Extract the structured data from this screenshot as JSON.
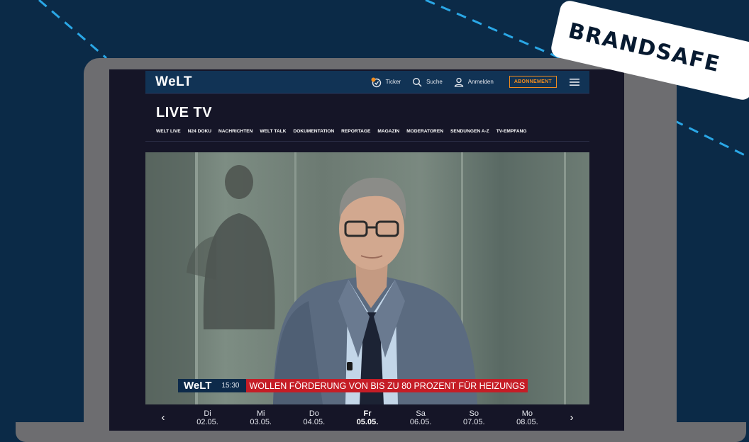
{
  "badge": {
    "label": "BRANDSAFE"
  },
  "site_header": {
    "logo": "WeLT",
    "ticker_label": "Ticker",
    "search_label": "Suche",
    "login_label": "Anmelden",
    "subscribe_label": "ABONNEMENT"
  },
  "page_title": "LIVE TV",
  "nav_items": [
    "WELT LIVE",
    "N24 DOKU",
    "NACHRICHTEN",
    "WELT TALK",
    "DOKUMENTATION",
    "REPORTAGE",
    "MAGAZIN",
    "MODERATOREN",
    "SENDUNGEN A-Z",
    "TV-EMPFANG"
  ],
  "lower_third": {
    "logo": "WeLT",
    "time": "15:30",
    "ticker": "WOLLEN FÖRDERUNG VON BIS ZU 80 PROZENT FÜR HEIZUNGS"
  },
  "days": [
    {
      "name": "Di",
      "date": "02.05."
    },
    {
      "name": "Mi",
      "date": "03.05."
    },
    {
      "name": "Do",
      "date": "04.05."
    },
    {
      "name": "Fr",
      "date": "05.05.",
      "active": true
    },
    {
      "name": "Sa",
      "date": "06.05."
    },
    {
      "name": "So",
      "date": "07.05."
    },
    {
      "name": "Mo",
      "date": "08.05."
    }
  ],
  "icons": {
    "prev": "chevron-left-icon",
    "next": "chevron-right-icon",
    "ticker": "ticker-icon",
    "search": "search-icon",
    "user": "user-icon",
    "menu": "hamburger-menu-icon"
  },
  "colors": {
    "background": "#0b2a47",
    "accent_orange": "#f08c1e",
    "ticker_red": "#c51d26",
    "header_blue": "#113355"
  }
}
